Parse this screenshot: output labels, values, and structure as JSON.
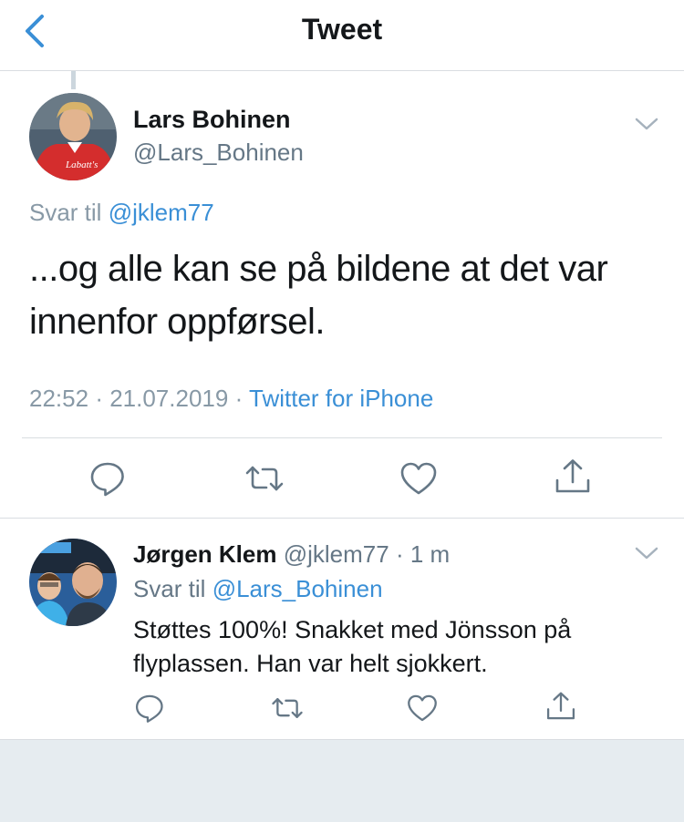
{
  "header": {
    "title": "Tweet",
    "back_icon": "chevron-left-icon"
  },
  "main_tweet": {
    "author_name": "Lars Bohinen",
    "author_handle": "@Lars_Bohinen",
    "reply_prefix": "Svar til",
    "reply_mention": "@jklem77",
    "text": "...og alle kan se på bildene at det var innenfor oppførsel.",
    "time": "22:52",
    "date": "21.07.2019",
    "source": "Twitter for iPhone",
    "avatar_text": "Labatt's"
  },
  "reply_tweet": {
    "author_name": "Jørgen Klem",
    "author_handle": "@jklem77",
    "time_ago": "1 m",
    "reply_prefix": "Svar til",
    "reply_mention": "@Lars_Bohinen",
    "text": "Støttes 100%! Snakket med Jönsson på flyplassen. Han var helt sjokkert."
  },
  "icons": {
    "reply": "reply-icon",
    "retweet": "retweet-icon",
    "like": "heart-icon",
    "share": "share-icon",
    "more": "chevron-down-icon"
  },
  "colors": {
    "accent": "#3a8fd6",
    "icon_gray": "#657786",
    "footer_bg": "#e6ecf0"
  }
}
